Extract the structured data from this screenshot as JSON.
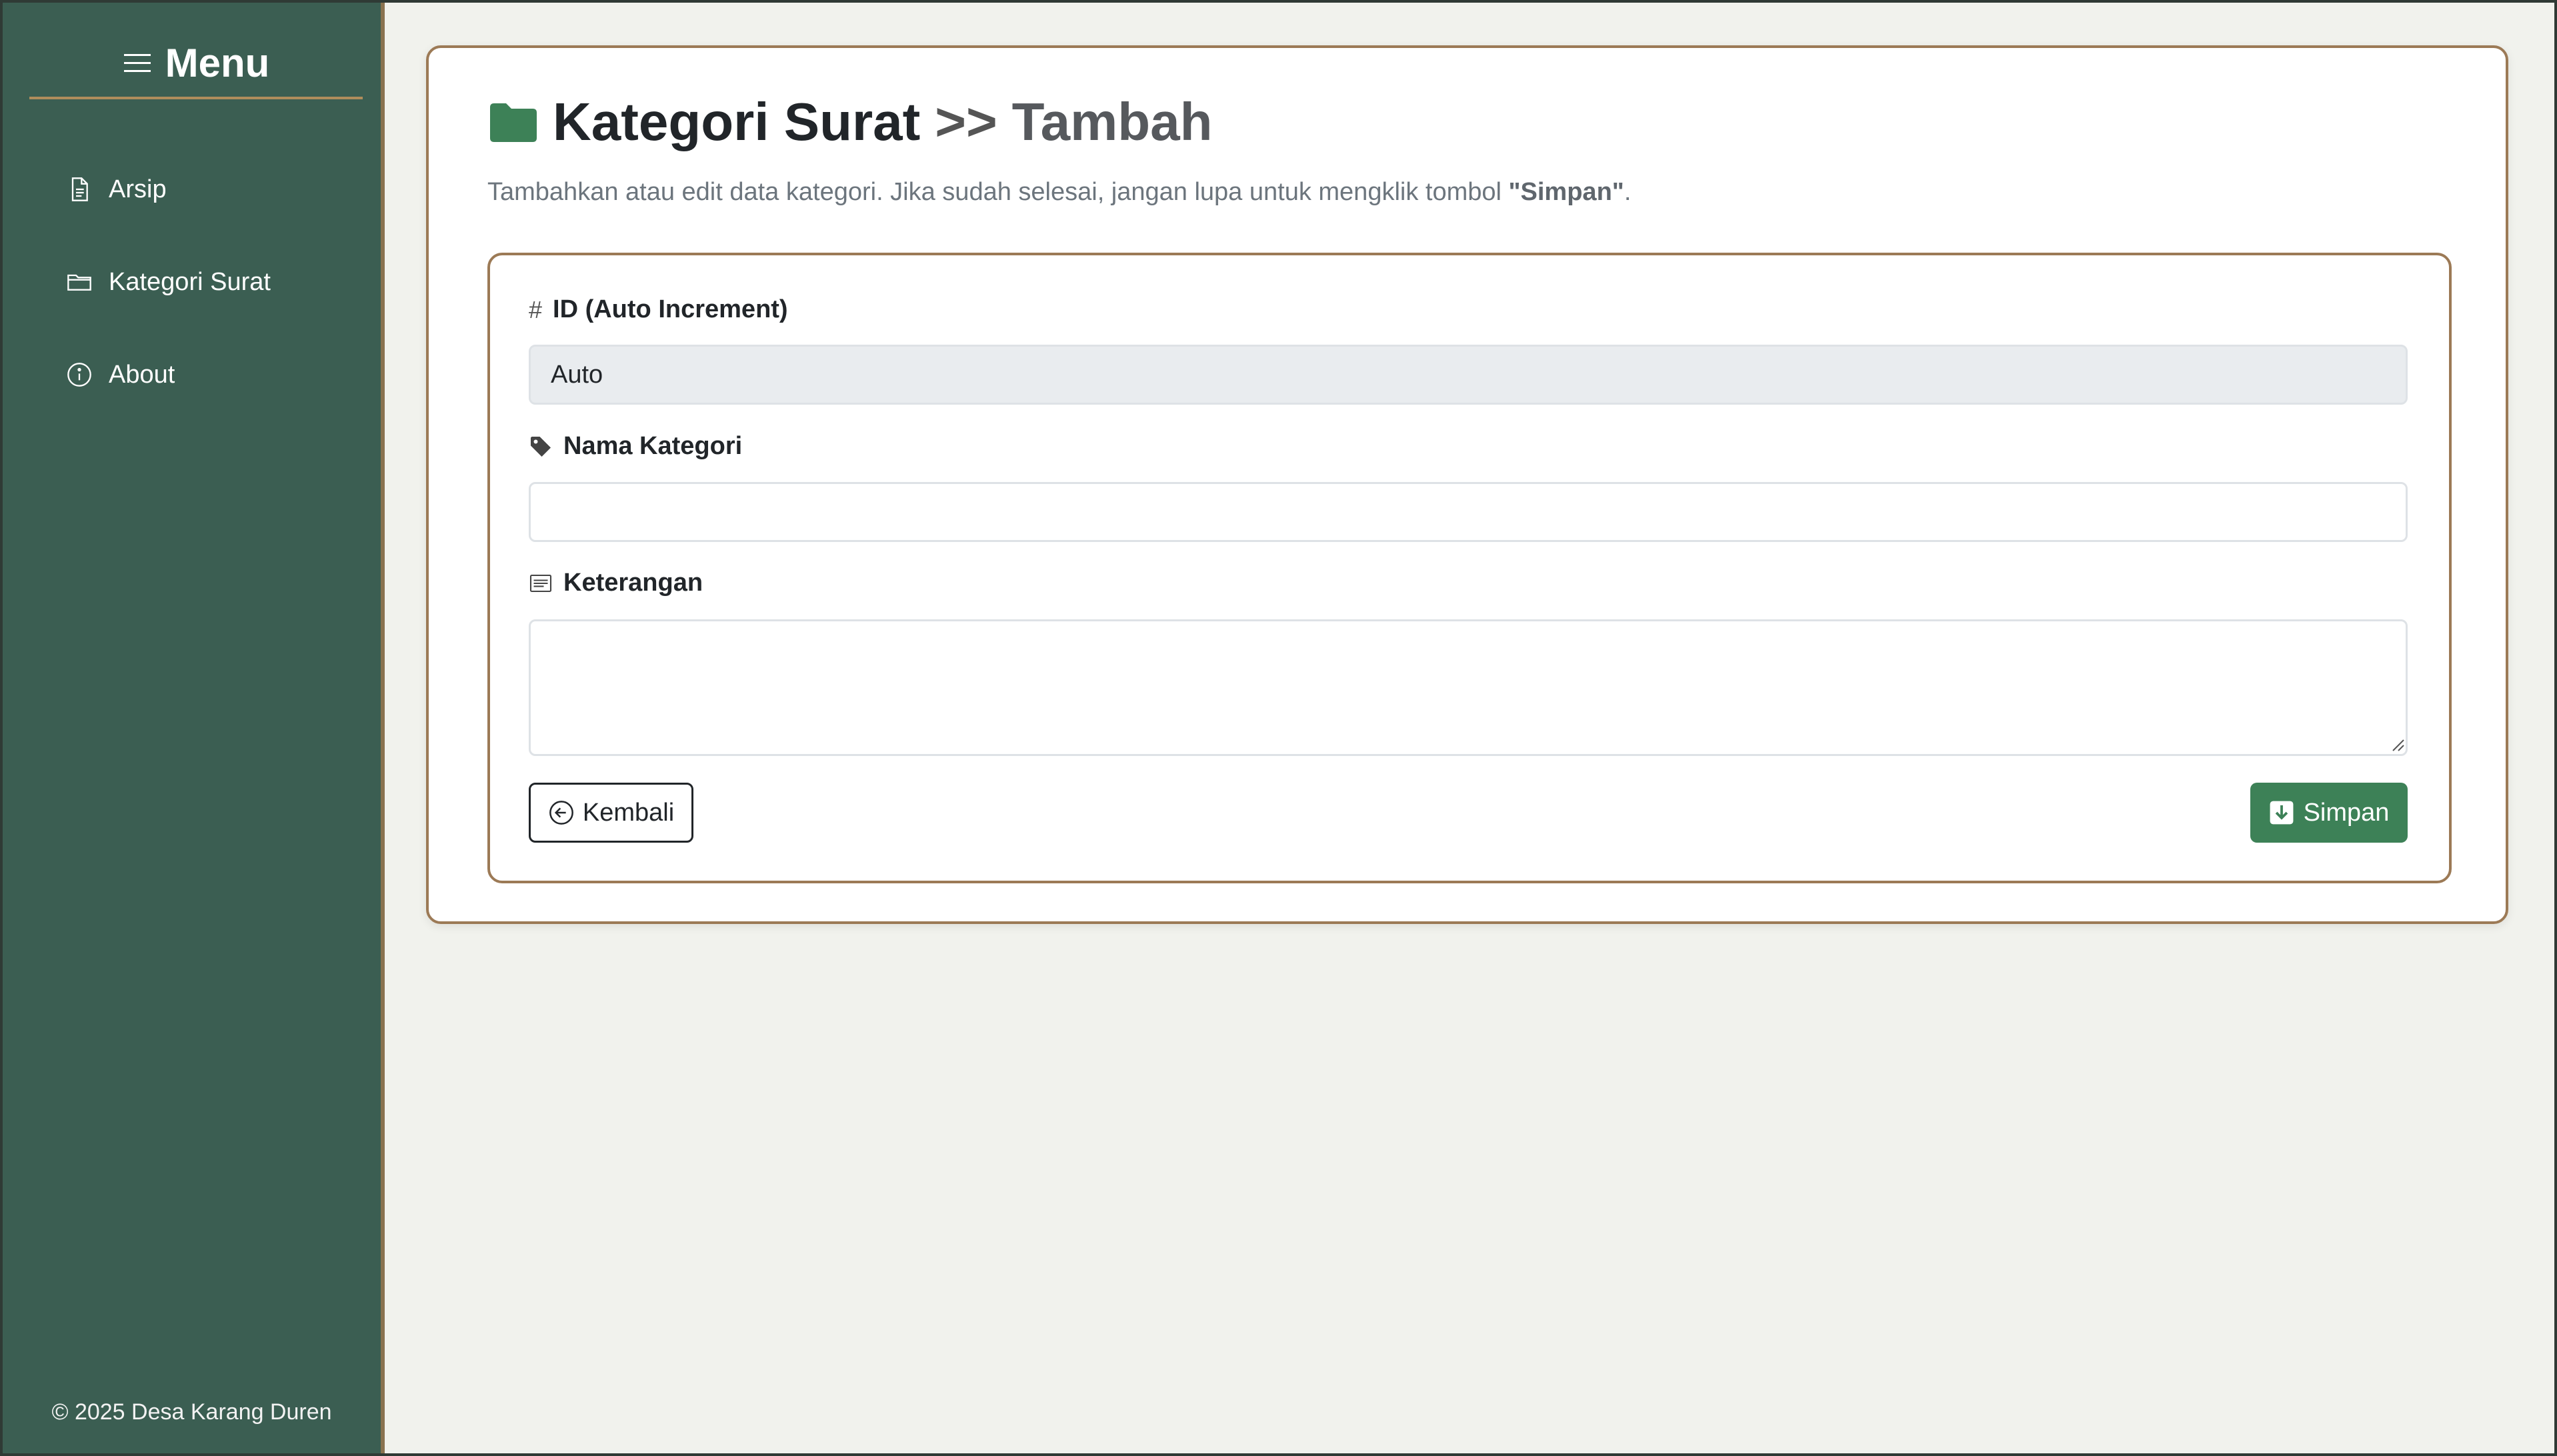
{
  "sidebar": {
    "menu_title": "Menu",
    "items": [
      {
        "label": "Arsip",
        "icon": "file-text-icon"
      },
      {
        "label": "Kategori Surat",
        "icon": "folder-icon"
      },
      {
        "label": "About",
        "icon": "info-icon"
      }
    ],
    "footer": "© 2025 Desa Karang Duren"
  },
  "header": {
    "title": "Kategori Surat",
    "separator": ">>",
    "subtitle": "Tambah",
    "description_prefix": "Tambahkan atau edit data kategori. Jika sudah selesai, jangan lupa untuk mengklik tombol ",
    "description_strong": "\"Simpan\"",
    "description_suffix": "."
  },
  "form": {
    "id_label": "ID (Auto Increment)",
    "id_value": "Auto",
    "nama_label": "Nama Kategori",
    "nama_value": "",
    "keterangan_label": "Keterangan",
    "keterangan_value": "",
    "back_label": "Kembali",
    "save_label": "Simpan"
  },
  "colors": {
    "sidebar": "#3b5e52",
    "accent_border": "#9c7a56",
    "primary": "#3d8157",
    "background": "#f1f2ed"
  }
}
